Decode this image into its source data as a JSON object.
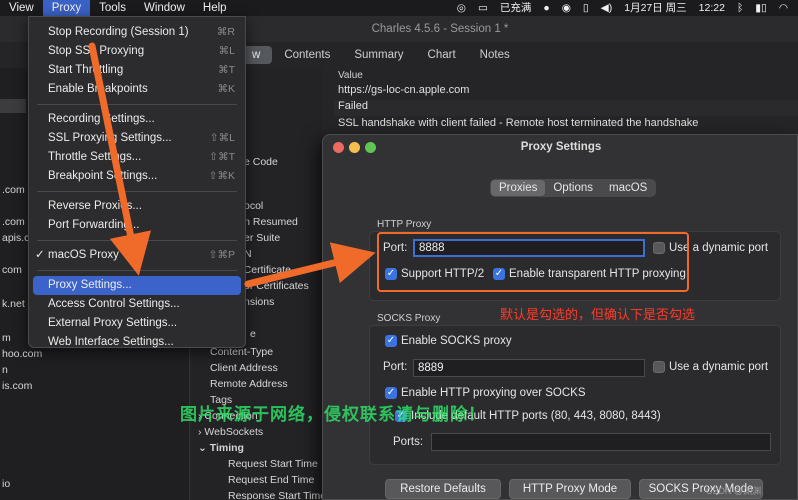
{
  "menubar": {
    "items": [
      "View",
      "Proxy",
      "Tools",
      "Window",
      "Help"
    ],
    "status": {
      "charging": "已充满",
      "date": "1月27日 周三",
      "time": "12:22"
    }
  },
  "window": {
    "title": "Charles 4.5.6 - Session 1 *"
  },
  "tabs": [
    "w",
    "Contents",
    "Summary",
    "Chart",
    "Notes"
  ],
  "value_pane": {
    "header": "Value",
    "lines": [
      "https://gs-loc-cn.apple.com",
      "Failed",
      "SSL handshake with client failed - Remote host terminated the handshake"
    ]
  },
  "left_hosts": [
    ".com",
    ".com",
    "apis.co",
    "com",
    "k.net",
    "m",
    "hoo.com",
    "n",
    "is.com",
    "io"
  ],
  "tree": {
    "fragments": [
      "e Code",
      "ocol",
      "ion Resumed",
      "er Suite",
      "N",
      "nt Certificate",
      "er Certificates",
      "nsions",
      "e"
    ],
    "rows": [
      "Content-Type",
      "Client Address",
      "Remote Address",
      "Tags",
      "Connection",
      "WebSockets",
      "Timing"
    ],
    "timing_rows": [
      "Request Start Time",
      "Request End Time",
      "Response Start Time"
    ]
  },
  "proxy_menu": {
    "items": [
      {
        "label": "Stop Recording (Session 1)",
        "shortcut": "⌘R"
      },
      {
        "label": "Stop SSL Proxying",
        "shortcut": "⌘L"
      },
      {
        "label": "Start Throttling",
        "shortcut": "⌘T"
      },
      {
        "label": "Enable Breakpoints",
        "shortcut": "⌘K"
      },
      {
        "label": "Recording Settings...",
        "shortcut": ""
      },
      {
        "label": "SSL Proxying Settings...",
        "shortcut": "⇧⌘L"
      },
      {
        "label": "Throttle Settings...",
        "shortcut": "⇧⌘T"
      },
      {
        "label": "Breakpoint Settings...",
        "shortcut": "⇧⌘K"
      },
      {
        "label": "Reverse Proxies...",
        "shortcut": ""
      },
      {
        "label": "Port Forwarding...",
        "shortcut": ""
      },
      {
        "label": "macOS Proxy",
        "shortcut": "⇧⌘P",
        "checked": "✓"
      },
      {
        "label": "Proxy Settings...",
        "shortcut": ""
      },
      {
        "label": "Access Control Settings...",
        "shortcut": ""
      },
      {
        "label": "External Proxy Settings...",
        "shortcut": ""
      },
      {
        "label": "Web Interface Settings...",
        "shortcut": ""
      }
    ]
  },
  "dialog": {
    "title": "Proxy Settings",
    "segments": [
      "Proxies",
      "Options",
      "macOS"
    ],
    "http_proxy": {
      "label": "HTTP Proxy",
      "port_label": "Port:",
      "port": "8888",
      "dynamic_port": "Use a dynamic port",
      "support_http2": "Support HTTP/2",
      "transparent": "Enable transparent HTTP proxying"
    },
    "socks_proxy": {
      "label": "SOCKS Proxy",
      "enable": "Enable SOCKS proxy",
      "port_label": "Port:",
      "port": "8889",
      "dynamic_port": "Use a dynamic port",
      "http_over_socks": "Enable HTTP proxying over SOCKS",
      "default_ports": "Include default HTTP ports (80, 443, 8080, 8443)",
      "ports_label": "Ports:"
    },
    "buttons": [
      "Restore Defaults",
      "HTTP Proxy Mode",
      "SOCKS Proxy Mode"
    ]
  },
  "annotations": {
    "red_note": "默认是勾选的，但确认下是否勾选",
    "green_watermark": "图片来源于网络，侵权联系请与删除！",
    "corner_watermark": "CSDN @渊渊"
  },
  "colors": {
    "accent": "#3b63c9",
    "annotation": "#f06a2a",
    "checkbox": "#3b74e0"
  }
}
